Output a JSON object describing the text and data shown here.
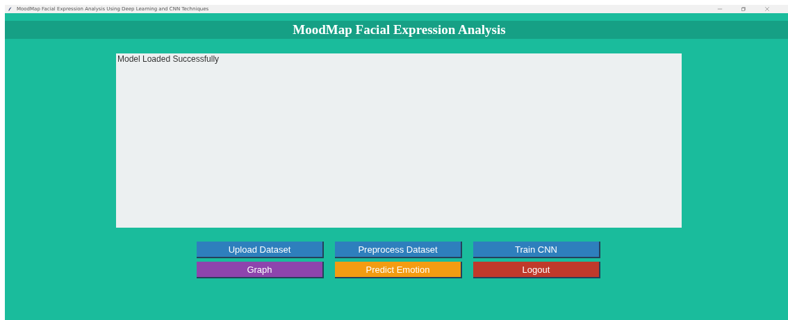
{
  "window": {
    "title": "MoodMap Facial Expression Analysis Using Deep Learning and CNN Techniques"
  },
  "header": {
    "title": "MoodMap Facial Expression Analysis"
  },
  "output": {
    "text": "Model Loaded Successfully"
  },
  "buttons": [
    {
      "label": "Upload Dataset",
      "color": "#2e7fbd"
    },
    {
      "label": "Preprocess Dataset",
      "color": "#2e7fbd"
    },
    {
      "label": "Train CNN",
      "color": "#2e7fbd"
    },
    {
      "label": "Graph",
      "color": "#8e44ad"
    },
    {
      "label": "Predict Emotion",
      "color": "#f39c12"
    },
    {
      "label": "Logout",
      "color": "#c0392b"
    }
  ]
}
